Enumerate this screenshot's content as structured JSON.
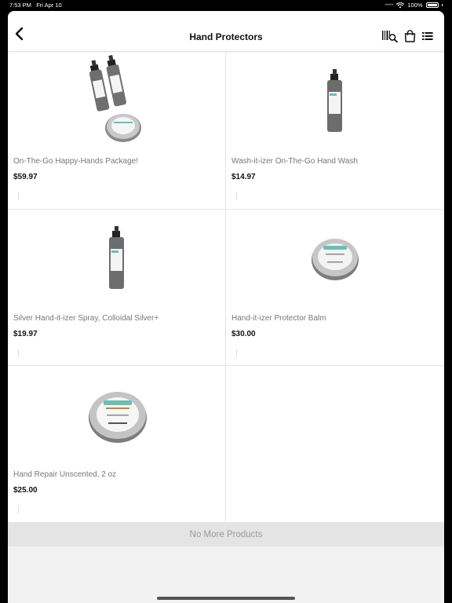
{
  "status_bar": {
    "time": "7:53 PM",
    "date": "Fri Apr 10",
    "battery": "100%",
    "icons": [
      "cellular-dots-icon",
      "wifi-icon",
      "battery-icon"
    ]
  },
  "header": {
    "title": "Hand Protectors",
    "icons": [
      "back-icon",
      "barcode-scan-icon",
      "shopping-bag-icon",
      "list-view-icon"
    ]
  },
  "products": [
    {
      "name": "On-The-Go Happy-Hands Package!",
      "price": "$59.97",
      "image": "spray-bottles-and-tin"
    },
    {
      "name": "Wash-it-izer On-The-Go Hand Wash",
      "price": "$14.97",
      "image": "single-spray-bottle"
    },
    {
      "name": "Silver Hand-it-izer Spray, Colloidal Silver+",
      "price": "$19.97",
      "image": "single-spray-bottle"
    },
    {
      "name": "Hand-it-izer Protector Balm",
      "price": "$30.00",
      "image": "small-tin"
    },
    {
      "name": "Hand Repair Unscented, 2 oz",
      "price": "$25.00",
      "image": "large-tin"
    }
  ],
  "footer": {
    "no_more_label": "No More Products"
  },
  "colors": {
    "background": "#f2f2f2",
    "divider": "#e4e4e4",
    "text_primary": "#111111",
    "text_secondary": "#777777"
  }
}
